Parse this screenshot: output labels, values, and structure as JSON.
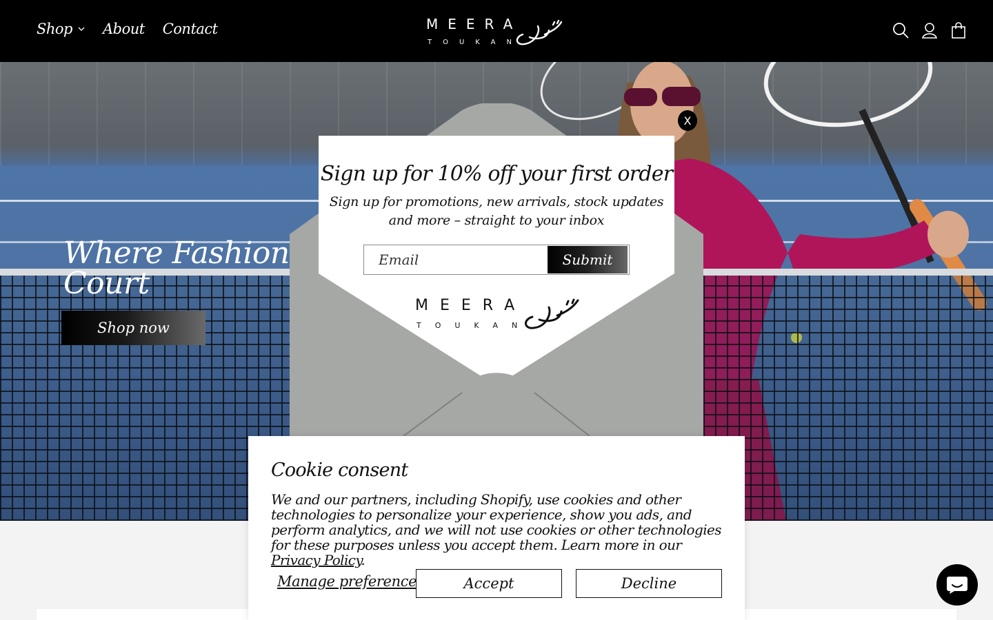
{
  "header": {
    "nav": [
      {
        "label": "Shop",
        "has_dropdown": true
      },
      {
        "label": "About"
      },
      {
        "label": "Contact"
      }
    ],
    "logo_text": "MEERA",
    "logo_subtext": "TOUKAN",
    "icons": [
      "search-icon",
      "account-icon",
      "cart-icon"
    ]
  },
  "hero": {
    "title": "Where Fashion Meets the Court",
    "title_visible": "Where Fashion Me",
    "title_line2": "Court",
    "cta": "Shop now"
  },
  "popup": {
    "close_label": "X",
    "title": "Sign up for 10% off your first order",
    "subtitle_line1": "Sign up for promotions, new arrivals, stock updates",
    "subtitle_line2": "and more – straight to your inbox",
    "email_placeholder": "Email",
    "submit_label": "Submit",
    "logo_text": "MEERA",
    "logo_subtext": "TOUKAN"
  },
  "cookie": {
    "title": "Cookie consent",
    "body": "We and our partners, including Shopify, use cookies and other technologies to personalize your experience, show you ads, and perform analytics, and we will not use cookies or other technologies for these purposes unless you accept them. Learn more in our",
    "link": "Privacy Policy",
    "period": ".",
    "manage": "Manage preferences",
    "accept": "Accept",
    "decline": "Decline"
  },
  "colors": {
    "header_bg": "#000000",
    "envelope": "#a6a8a5",
    "court_blue": "#4d73a4",
    "jacket": "#b0155a"
  }
}
